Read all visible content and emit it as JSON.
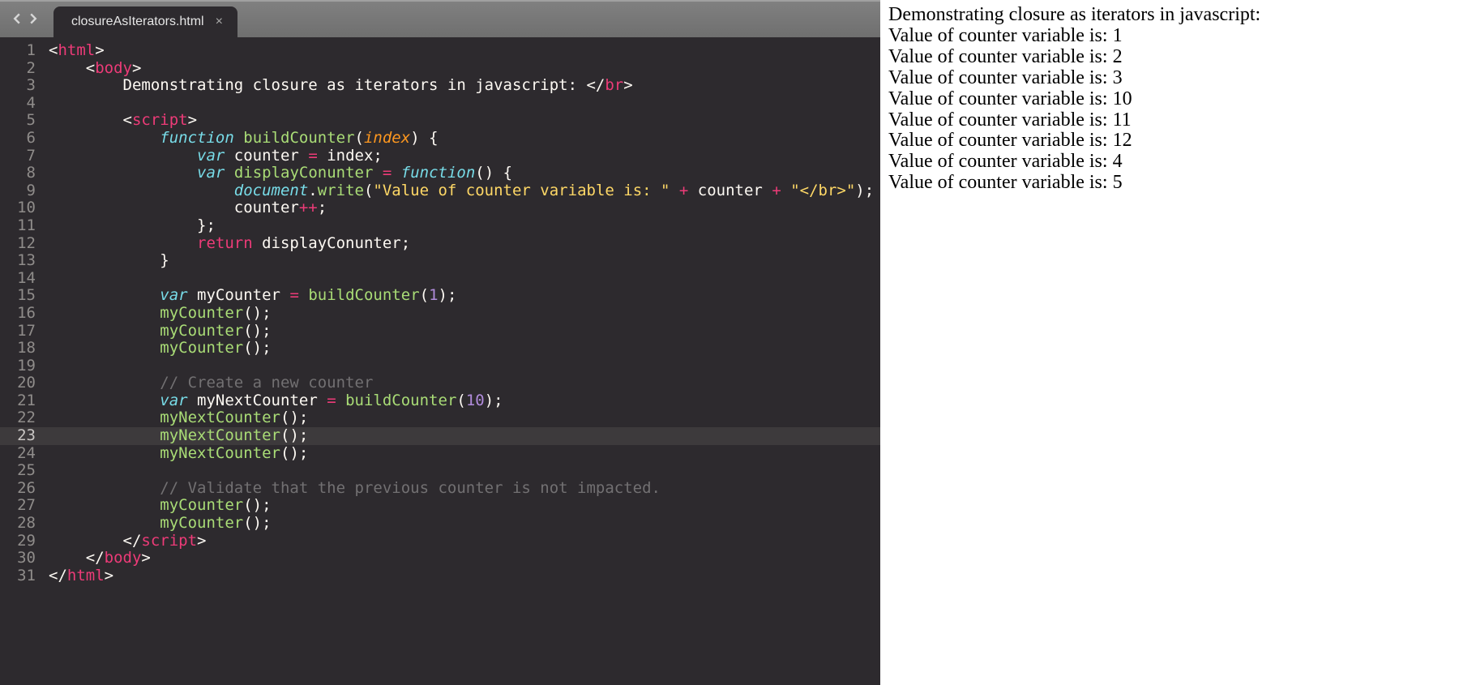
{
  "tab": {
    "filename": "closureAsIterators.html"
  },
  "editor": {
    "active_line": 23,
    "lines": [
      {
        "n": 1,
        "t": [
          [
            "c-punct",
            "<"
          ],
          [
            "c-tag",
            "html"
          ],
          [
            "c-punct",
            ">"
          ]
        ]
      },
      {
        "n": 2,
        "t": [
          [
            "",
            "    "
          ],
          [
            "c-punct",
            "<"
          ],
          [
            "c-tag",
            "body"
          ],
          [
            "c-punct",
            ">"
          ]
        ]
      },
      {
        "n": 3,
        "t": [
          [
            "",
            "        Demonstrating closure as iterators in javascript: "
          ],
          [
            "c-punct",
            "</"
          ],
          [
            "c-tag",
            "br"
          ],
          [
            "c-punct",
            ">"
          ]
        ]
      },
      {
        "n": 4,
        "t": [
          [
            "",
            ""
          ]
        ]
      },
      {
        "n": 5,
        "t": [
          [
            "",
            "        "
          ],
          [
            "c-punct",
            "<"
          ],
          [
            "c-tag",
            "script"
          ],
          [
            "c-punct",
            ">"
          ]
        ]
      },
      {
        "n": 6,
        "t": [
          [
            "",
            "            "
          ],
          [
            "c-kw2",
            "function"
          ],
          [
            "",
            " "
          ],
          [
            "c-fn",
            "buildCounter"
          ],
          [
            "c-punct",
            "("
          ],
          [
            "c-param",
            "index"
          ],
          [
            "c-punct",
            ") {"
          ]
        ]
      },
      {
        "n": 7,
        "t": [
          [
            "",
            "                "
          ],
          [
            "c-var",
            "var"
          ],
          [
            "",
            " counter "
          ],
          [
            "c-op",
            "="
          ],
          [
            "",
            " index;"
          ]
        ]
      },
      {
        "n": 8,
        "t": [
          [
            "",
            "                "
          ],
          [
            "c-var",
            "var"
          ],
          [
            "",
            " "
          ],
          [
            "c-fn",
            "displayConunter"
          ],
          [
            "",
            " "
          ],
          [
            "c-op",
            "="
          ],
          [
            "",
            " "
          ],
          [
            "c-kw2",
            "function"
          ],
          [
            "c-punct",
            "() {"
          ]
        ]
      },
      {
        "n": 9,
        "t": [
          [
            "",
            "                    "
          ],
          [
            "c-obj",
            "document"
          ],
          [
            "c-punct",
            "."
          ],
          [
            "c-fn",
            "write"
          ],
          [
            "c-punct",
            "("
          ],
          [
            "c-str",
            "\"Value of counter variable is: \""
          ],
          [
            "",
            " "
          ],
          [
            "c-op",
            "+"
          ],
          [
            "",
            " counter "
          ],
          [
            "c-op",
            "+"
          ],
          [
            "",
            " "
          ],
          [
            "c-str",
            "\"</br>\""
          ],
          [
            "c-punct",
            ");"
          ]
        ]
      },
      {
        "n": 10,
        "t": [
          [
            "",
            "                    counter"
          ],
          [
            "c-op",
            "++"
          ],
          [
            "c-punct",
            ";"
          ]
        ]
      },
      {
        "n": 11,
        "t": [
          [
            "",
            "                "
          ],
          [
            "c-punct",
            "};"
          ]
        ]
      },
      {
        "n": 12,
        "t": [
          [
            "",
            "                "
          ],
          [
            "c-ret",
            "return"
          ],
          [
            "",
            " displayConunter;"
          ]
        ]
      },
      {
        "n": 13,
        "t": [
          [
            "",
            "            "
          ],
          [
            "c-punct",
            "}"
          ]
        ]
      },
      {
        "n": 14,
        "t": [
          [
            "",
            ""
          ]
        ]
      },
      {
        "n": 15,
        "t": [
          [
            "",
            "            "
          ],
          [
            "c-var",
            "var"
          ],
          [
            "",
            " myCounter "
          ],
          [
            "c-op",
            "="
          ],
          [
            "",
            " "
          ],
          [
            "c-fn",
            "buildCounter"
          ],
          [
            "c-punct",
            "("
          ],
          [
            "c-num",
            "1"
          ],
          [
            "c-punct",
            ");"
          ]
        ]
      },
      {
        "n": 16,
        "t": [
          [
            "",
            "            "
          ],
          [
            "c-fn",
            "myCounter"
          ],
          [
            "c-punct",
            "();"
          ]
        ]
      },
      {
        "n": 17,
        "t": [
          [
            "",
            "            "
          ],
          [
            "c-fn",
            "myCounter"
          ],
          [
            "c-punct",
            "();"
          ]
        ]
      },
      {
        "n": 18,
        "t": [
          [
            "",
            "            "
          ],
          [
            "c-fn",
            "myCounter"
          ],
          [
            "c-punct",
            "();"
          ]
        ]
      },
      {
        "n": 19,
        "t": [
          [
            "",
            ""
          ]
        ]
      },
      {
        "n": 20,
        "t": [
          [
            "",
            "            "
          ],
          [
            "c-cmt",
            "// Create a new counter"
          ]
        ]
      },
      {
        "n": 21,
        "t": [
          [
            "",
            "            "
          ],
          [
            "c-var",
            "var"
          ],
          [
            "",
            " myNextCounter "
          ],
          [
            "c-op",
            "="
          ],
          [
            "",
            " "
          ],
          [
            "c-fn",
            "buildCounter"
          ],
          [
            "c-punct",
            "("
          ],
          [
            "c-num",
            "10"
          ],
          [
            "c-punct",
            ");"
          ]
        ]
      },
      {
        "n": 22,
        "t": [
          [
            "",
            "            "
          ],
          [
            "c-fn",
            "myNextCounter"
          ],
          [
            "c-punct",
            "();"
          ]
        ]
      },
      {
        "n": 23,
        "t": [
          [
            "",
            "            "
          ],
          [
            "c-fn",
            "myNextCounter"
          ],
          [
            "c-punct",
            "();"
          ]
        ]
      },
      {
        "n": 24,
        "t": [
          [
            "",
            "            "
          ],
          [
            "c-fn",
            "myNextCounter"
          ],
          [
            "c-punct",
            "();"
          ]
        ]
      },
      {
        "n": 25,
        "t": [
          [
            "",
            ""
          ]
        ]
      },
      {
        "n": 26,
        "t": [
          [
            "",
            "            "
          ],
          [
            "c-cmt",
            "// Validate that the previous counter is not impacted."
          ]
        ]
      },
      {
        "n": 27,
        "t": [
          [
            "",
            "            "
          ],
          [
            "c-fn",
            "myCounter"
          ],
          [
            "c-punct",
            "();"
          ]
        ]
      },
      {
        "n": 28,
        "t": [
          [
            "",
            "            "
          ],
          [
            "c-fn",
            "myCounter"
          ],
          [
            "c-punct",
            "();"
          ]
        ]
      },
      {
        "n": 29,
        "t": [
          [
            "",
            "        "
          ],
          [
            "c-punct",
            "</"
          ],
          [
            "c-tag",
            "script"
          ],
          [
            "c-punct",
            ">"
          ]
        ]
      },
      {
        "n": 30,
        "t": [
          [
            "",
            "    "
          ],
          [
            "c-punct",
            "</"
          ],
          [
            "c-tag",
            "body"
          ],
          [
            "c-punct",
            ">"
          ]
        ]
      },
      {
        "n": 31,
        "t": [
          [
            "c-punct",
            "</"
          ],
          [
            "c-tag",
            "html"
          ],
          [
            "c-punct",
            ">"
          ]
        ]
      }
    ]
  },
  "output": {
    "lines": [
      "Demonstrating closure as iterators in javascript:",
      "Value of counter variable is: 1",
      "Value of counter variable is: 2",
      "Value of counter variable is: 3",
      "Value of counter variable is: 10",
      "Value of counter variable is: 11",
      "Value of counter variable is: 12",
      "Value of counter variable is: 4",
      "Value of counter variable is: 5"
    ]
  }
}
